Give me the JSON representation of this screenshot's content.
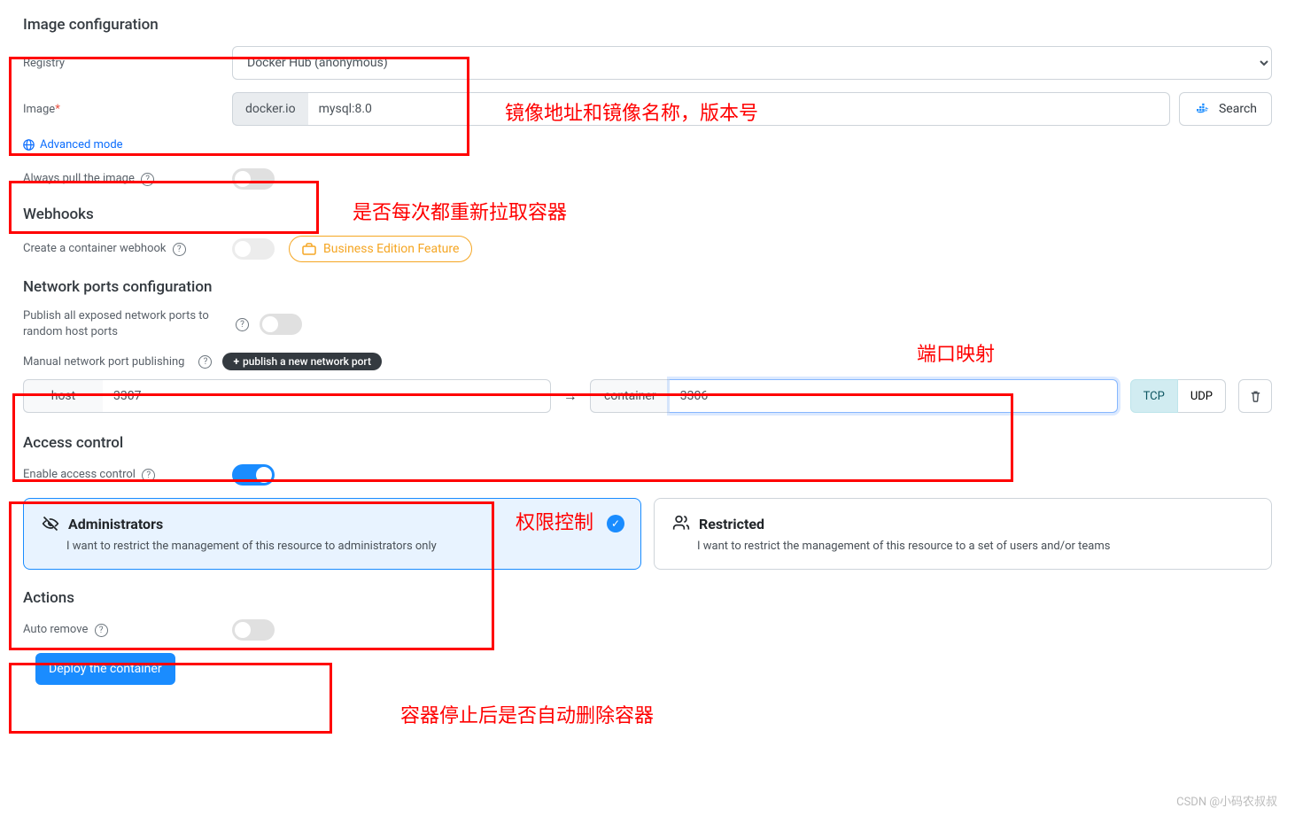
{
  "sections": {
    "image_config_title": "Image configuration",
    "webhooks_title": "Webhooks",
    "network_title": "Network ports configuration",
    "access_title": "Access control",
    "actions_title": "Actions"
  },
  "registry": {
    "label": "Registry",
    "value": "Docker Hub (anonymous)"
  },
  "image": {
    "label": "Image",
    "required_marker": "*",
    "prefix": "docker.io",
    "value": "mysql:8.0",
    "search_label": "Search"
  },
  "advanced_mode_label": "Advanced mode",
  "always_pull": {
    "label": "Always pull the image",
    "value": false
  },
  "webhook": {
    "label": "Create a container webhook",
    "be_label": "Business Edition Feature"
  },
  "publish_random": {
    "label": "Publish all exposed network ports to random host ports",
    "value": false
  },
  "manual_publish": {
    "label": "Manual network port publishing",
    "add_button": "publish a new network port",
    "host_label": "host",
    "host_value": "3307",
    "container_label": "container",
    "container_value": "3306",
    "proto_tcp": "TCP",
    "proto_udp": "UDP"
  },
  "access_control": {
    "label": "Enable access control",
    "value": true
  },
  "cards": {
    "admin_title": "Administrators",
    "admin_desc": "I want to restrict the management of this resource to administrators only",
    "restricted_title": "Restricted",
    "restricted_desc": "I want to restrict the management of this resource to a set of users and/or teams"
  },
  "auto_remove": {
    "label": "Auto remove",
    "value": false
  },
  "deploy_button": "Deploy the container",
  "annotations": {
    "a1": "镜像地址和镜像名称，版本号",
    "a2": "是否每次都重新拉取容器",
    "a3": "端口映射",
    "a4": "权限控制",
    "a5": "容器停止后是否自动删除容器"
  },
  "watermark": "CSDN @小码农叔叔"
}
